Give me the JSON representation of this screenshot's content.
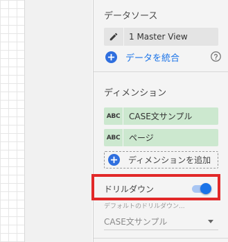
{
  "data_source": {
    "section_title": "データソース",
    "source_name": "1 Master View",
    "blend_label": "データを統合"
  },
  "dimensions": {
    "section_title": "ディメンション",
    "items": [
      {
        "type_label": "ABC",
        "name": "CASE文サンプル"
      },
      {
        "type_label": "ABC",
        "name": "ページ"
      }
    ],
    "add_label": "ディメンションを追加"
  },
  "drilldown": {
    "label": "ドリルダウン",
    "enabled": true,
    "default_caption": "デフォルトのドリルダウン...",
    "default_value": "CASE文サンプル"
  },
  "colors": {
    "accent": "#1a73e8",
    "chip_green": "#cce8cf",
    "highlight_red": "#e22929"
  },
  "icons": [
    "pencil-icon",
    "add-circle-icon",
    "help-circle-icon",
    "dropdown-arrow-icon"
  ]
}
